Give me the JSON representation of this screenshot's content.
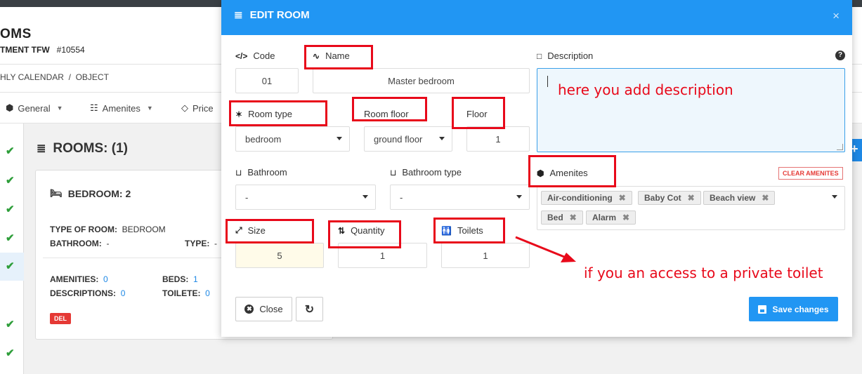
{
  "page": {
    "title": "OMS",
    "subtitle": "TMENT TFW",
    "id": "#10554",
    "breadcrumb": "HLY CALENDAR  /  OBJECT",
    "tabs": [
      {
        "label": "General"
      },
      {
        "label": "Amenites"
      },
      {
        "label": "Price"
      }
    ]
  },
  "rooms": {
    "title": "ROOMS: (1)",
    "card": {
      "heading": "BEDROOM: 2",
      "type_of_room_label": "TYPE OF ROOM:",
      "type_of_room_value": "BEDROOM",
      "bathroom_label": "BATHROOM:",
      "bathroom_value": "-",
      "type_label": "TYPE:",
      "type_value": "-",
      "amenities_label": "AMENITIES:",
      "amenities_value": "0",
      "beds_label": "BEDS:",
      "beds_value": "1",
      "descriptions_label": "DESCRIPTIONS:",
      "descriptions_value": "0",
      "toilete_label": "TOILETE:",
      "toilete_value": "0",
      "del_label": "DEL"
    }
  },
  "modal": {
    "title": "EDIT ROOM",
    "close_glyph": "×",
    "fields": {
      "code": {
        "label": "Code",
        "value": "01"
      },
      "name": {
        "label": "Name",
        "value": "Master bedroom"
      },
      "description": {
        "label": "Description",
        "value": ""
      },
      "room_type": {
        "label": "Room type",
        "value": "bedroom"
      },
      "room_floor": {
        "label": "Room floor",
        "value": "ground floor"
      },
      "floor": {
        "label": "Floor",
        "value": "1"
      },
      "bathroom": {
        "label": "Bathroom",
        "value": "-"
      },
      "bathroom_type": {
        "label": "Bathroom type",
        "value": "-"
      },
      "amenites": {
        "label": "Amenites",
        "clear_label": "CLEAR AMENITES",
        "tags": [
          "Air-conditioning",
          "Baby Cot",
          "Beach view",
          "Bed",
          "Alarm"
        ]
      },
      "size": {
        "label": "Size",
        "value": "5"
      },
      "quantity": {
        "label": "Quantity",
        "value": "1"
      },
      "toilets": {
        "label": "Toilets",
        "value": "1"
      }
    },
    "buttons": {
      "close": "Close",
      "save": "Save changes"
    }
  },
  "annotations": {
    "description_note": "here you add description",
    "toilet_note": "if you an access to a private toilet"
  },
  "colors": {
    "primary": "#2196f3",
    "annotation": "#e8091a",
    "check": "#2e9e3a"
  }
}
